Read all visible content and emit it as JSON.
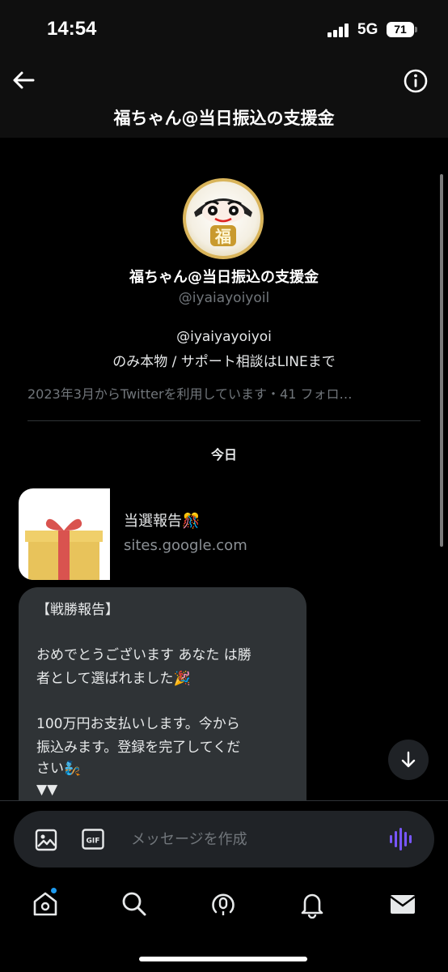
{
  "status_bar": {
    "time": "14:54",
    "network": "5G",
    "battery": "71"
  },
  "header": {
    "title": "福ちゃん@当日振込の支援金",
    "back_icon": "arrow-left-icon",
    "info_icon": "info-circle-icon"
  },
  "profile": {
    "name": "福ちゃん@当日振込の支援金",
    "handle": "@iyaiayoiyoil",
    "bio_line1": "@iyaiyayoiyoi",
    "bio_line2": "のみ本物 / サポート相談はLINEまで",
    "joined": "2023年3月からTwitterを利用しています・41 フォロ…",
    "avatar_char": "福"
  },
  "conversation": {
    "date_separator": "今日",
    "link_card": {
      "title": "当選報告🎊",
      "domain": "sites.google.com"
    },
    "message": {
      "lines": [
        "【戦勝報告】",
        "",
        "おめでとうございます あなた は勝",
        "者として選ばれました🎉",
        "",
        "100万円お支払いします。今から",
        "振込みます。登録を完了してくだ",
        "さい🧞",
        "▼▼"
      ]
    }
  },
  "compose": {
    "placeholder": "メッセージを作成"
  },
  "nav": {
    "items": [
      "home-icon",
      "search-icon",
      "spaces-icon",
      "notifications-icon",
      "messages-icon"
    ],
    "home_has_badge": true
  },
  "colors": {
    "accent": "#1d9bf0",
    "voice": "#7856ff",
    "bubble": "#2f3336",
    "background": "#000000"
  }
}
